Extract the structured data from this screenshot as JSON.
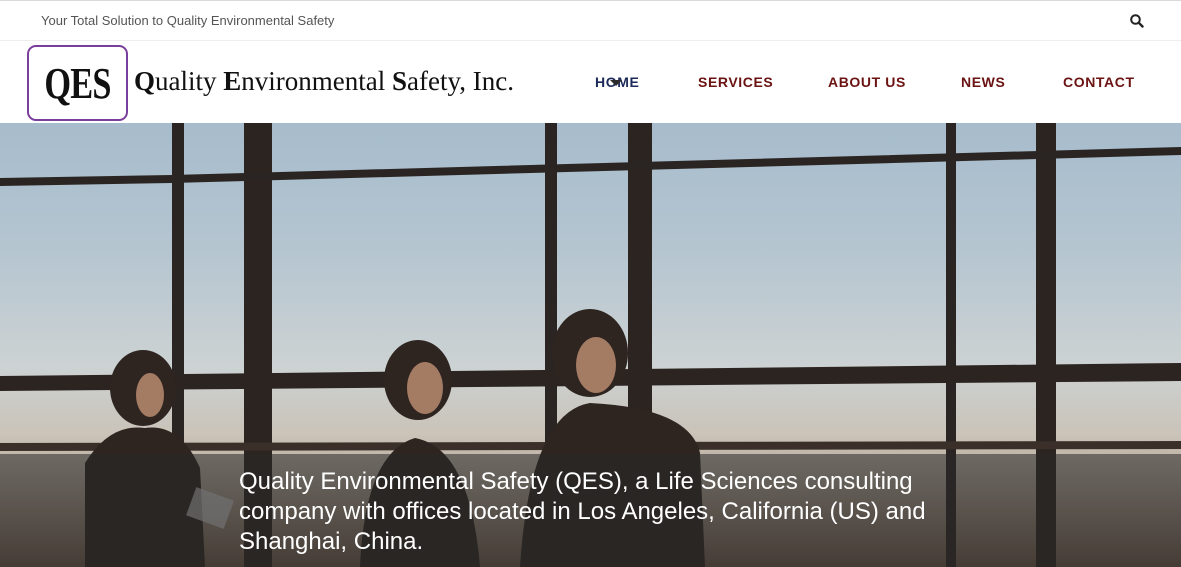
{
  "topbar": {
    "tagline": "Your Total Solution to Quality Environmental Safety",
    "search_icon": "search-icon"
  },
  "header": {
    "logo_text": "QES",
    "company_name": "Quality Environmental Safety, Inc."
  },
  "nav": {
    "items": [
      {
        "label": "HOME",
        "active": true
      },
      {
        "label": "SERVICES",
        "active": false
      },
      {
        "label": "ABOUT US",
        "active": false
      },
      {
        "label": "NEWS",
        "active": false
      },
      {
        "label": "CONTACT",
        "active": false
      }
    ]
  },
  "hero": {
    "caption": "Quality Environmental Safety (QES), a Life Sciences consulting company with offices located in Los Angeles, California (US) and Shanghai, China."
  },
  "colors": {
    "logo_border": "#7a3f9c",
    "nav_active": "#1c2a5a",
    "nav_default": "#6b1212"
  }
}
